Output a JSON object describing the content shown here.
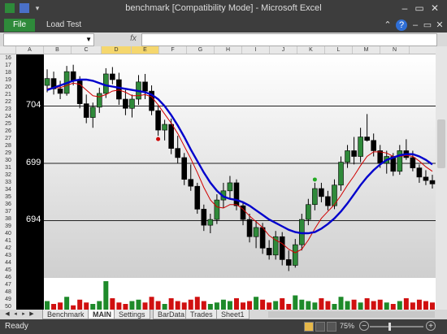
{
  "window": {
    "title": "benchmark  [Compatibility Mode]  -  Microsoft Excel"
  },
  "ribbon": {
    "file_label": "File",
    "tabs": [
      "Load Test"
    ]
  },
  "formula_bar": {
    "fx": "fx",
    "value": ""
  },
  "column_headers": [
    "A",
    "B",
    "C",
    "D",
    "E",
    "F",
    "G",
    "H",
    "I",
    "J",
    "K",
    "L",
    "M",
    "N"
  ],
  "selected_columns": [
    "D",
    "E"
  ],
  "row_headers": [
    "16",
    "17",
    "18",
    "19",
    "20",
    "21",
    "22",
    "23",
    "24",
    "25",
    "26",
    "27",
    "28",
    "29",
    "30",
    "31",
    "32",
    "33",
    "34",
    "35",
    "36",
    "37",
    "38",
    "39",
    "40",
    "41",
    "42",
    "43",
    "44",
    "45",
    "46",
    "47",
    "48",
    "49",
    "50"
  ],
  "sheet_tabs": [
    "Benchmark",
    "MAIN",
    "Settings",
    "BarData",
    "Trades",
    "Sheet1"
  ],
  "active_sheet": "MAIN",
  "status": {
    "ready": "Ready",
    "zoom": "75%"
  },
  "colors": {
    "up": "#2f8a3a",
    "down": "#000000",
    "ma_fast": "#d00000",
    "ma_slow": "#0000cc",
    "volume_up": "#1e8a2a",
    "volume_down": "#d01010",
    "signal_up": "#22aa22",
    "signal_down": "#cc0000"
  },
  "chart_data": {
    "type": "candlestick",
    "y_ticks": [
      704,
      699,
      694
    ],
    "ylim": [
      689.0,
      708.5
    ],
    "gridlines": true,
    "ohlc": [
      [
        705.8,
        707.2,
        705.2,
        706.4
      ],
      [
        706.4,
        707.0,
        705.0,
        705.5
      ],
      [
        705.5,
        706.2,
        704.6,
        705.1
      ],
      [
        705.1,
        707.5,
        704.9,
        707.0
      ],
      [
        707.0,
        707.6,
        705.8,
        706.2
      ],
      [
        706.2,
        706.6,
        703.8,
        704.2
      ],
      [
        704.2,
        705.0,
        702.5,
        703.0
      ],
      [
        703.0,
        704.3,
        702.1,
        703.9
      ],
      [
        703.9,
        705.6,
        703.4,
        705.1
      ],
      [
        705.1,
        707.3,
        704.7,
        706.8
      ],
      [
        706.8,
        707.4,
        705.9,
        706.3
      ],
      [
        706.3,
        706.9,
        704.1,
        704.6
      ],
      [
        704.6,
        705.4,
        703.2,
        703.8
      ],
      [
        703.8,
        705.0,
        703.0,
        704.6
      ],
      [
        704.6,
        706.7,
        704.1,
        706.1
      ],
      [
        706.1,
        706.8,
        704.6,
        705.3
      ],
      [
        705.3,
        705.8,
        703.2,
        703.6
      ],
      [
        703.6,
        704.0,
        701.4,
        701.9
      ],
      [
        701.9,
        702.8,
        701.0,
        702.4
      ],
      [
        702.4,
        702.9,
        699.8,
        700.3
      ],
      [
        700.3,
        701.4,
        699.0,
        699.5
      ],
      [
        699.5,
        699.9,
        697.1,
        697.6
      ],
      [
        697.6,
        698.9,
        696.6,
        697.0
      ],
      [
        697.0,
        697.3,
        694.6,
        695.0
      ],
      [
        695.0,
        695.4,
        693.1,
        693.6
      ],
      [
        693.6,
        694.6,
        692.9,
        694.1
      ],
      [
        694.1,
        696.3,
        693.7,
        695.8
      ],
      [
        695.8,
        697.3,
        695.1,
        696.6
      ],
      [
        696.6,
        697.9,
        695.9,
        697.3
      ],
      [
        697.3,
        697.6,
        694.9,
        695.3
      ],
      [
        695.3,
        695.6,
        693.6,
        694.1
      ],
      [
        694.1,
        694.6,
        692.1,
        692.6
      ],
      [
        692.6,
        694.0,
        691.6,
        693.4
      ],
      [
        693.4,
        693.8,
        691.1,
        691.6
      ],
      [
        691.6,
        692.3,
        690.6,
        691.0
      ],
      [
        691.0,
        693.1,
        690.6,
        692.6
      ],
      [
        692.6,
        693.0,
        690.1,
        690.6
      ],
      [
        690.6,
        691.4,
        689.6,
        690.1
      ],
      [
        690.1,
        692.4,
        689.9,
        691.9
      ],
      [
        691.9,
        694.6,
        691.4,
        694.1
      ],
      [
        694.1,
        695.9,
        693.6,
        695.4
      ],
      [
        695.4,
        697.3,
        694.9,
        696.8
      ],
      [
        696.8,
        697.3,
        695.6,
        696.1
      ],
      [
        696.1,
        696.6,
        694.9,
        695.3
      ],
      [
        695.3,
        697.6,
        695.0,
        697.1
      ],
      [
        697.1,
        699.6,
        696.6,
        699.1
      ],
      [
        699.1,
        700.6,
        698.6,
        700.1
      ],
      [
        700.1,
        701.3,
        698.9,
        699.6
      ],
      [
        699.6,
        702.1,
        699.1,
        701.3
      ],
      [
        701.3,
        703.3,
        700.9,
        701.0
      ],
      [
        701.0,
        701.6,
        699.6,
        700.1
      ],
      [
        700.1,
        700.6,
        698.6,
        699.0
      ],
      [
        699.0,
        700.1,
        698.1,
        699.6
      ],
      [
        699.6,
        699.9,
        697.9,
        698.3
      ],
      [
        698.3,
        700.6,
        698.0,
        700.1
      ],
      [
        700.1,
        701.1,
        699.3,
        699.5
      ],
      [
        699.5,
        700.1,
        698.3,
        698.6
      ],
      [
        698.6,
        698.9,
        697.3,
        697.8
      ],
      [
        697.8,
        698.4,
        697.1,
        697.5
      ],
      [
        697.5,
        698.0,
        696.8,
        697.2
      ]
    ],
    "ma_fast": [
      705.5,
      705.6,
      705.6,
      705.8,
      706.0,
      705.9,
      705.4,
      704.9,
      704.8,
      705.0,
      705.3,
      705.4,
      705.2,
      704.9,
      704.9,
      705.0,
      704.8,
      704.1,
      703.3,
      702.5,
      701.6,
      700.5,
      699.4,
      698.2,
      696.9,
      695.8,
      695.2,
      695.1,
      695.4,
      695.4,
      695.0,
      694.4,
      693.9,
      693.4,
      692.7,
      692.3,
      692.0,
      691.5,
      691.2,
      691.5,
      692.3,
      693.3,
      694.2,
      694.8,
      695.4,
      696.2,
      697.1,
      697.9,
      698.8,
      699.6,
      700.0,
      700.0,
      699.9,
      699.6,
      699.6,
      699.7,
      699.6,
      699.2,
      698.7,
      698.3
    ],
    "ma_slow": [
      705.4,
      705.6,
      705.8,
      706.0,
      706.2,
      706.3,
      706.3,
      706.2,
      706.0,
      705.8,
      705.7,
      705.6,
      705.5,
      705.4,
      705.3,
      705.2,
      705.0,
      704.6,
      704.0,
      703.2,
      702.3,
      701.3,
      700.2,
      699.2,
      698.2,
      697.3,
      696.6,
      696.1,
      695.9,
      695.8,
      695.6,
      695.3,
      694.9,
      694.5,
      694.1,
      693.8,
      693.5,
      693.2,
      693.0,
      692.9,
      692.9,
      693.0,
      693.3,
      693.7,
      694.2,
      694.8,
      695.5,
      696.3,
      697.1,
      697.8,
      698.4,
      698.9,
      699.3,
      699.5,
      699.7,
      699.8,
      699.8,
      699.6,
      699.3,
      698.9
    ],
    "volume": [
      6,
      4,
      5,
      9,
      3,
      7,
      5,
      4,
      6,
      20,
      8,
      5,
      4,
      6,
      7,
      5,
      9,
      6,
      4,
      8,
      6,
      5,
      7,
      9,
      6,
      4,
      5,
      7,
      6,
      8,
      5,
      6,
      9,
      7,
      5,
      6,
      8,
      4,
      10,
      7,
      6,
      5,
      8,
      6,
      4,
      9,
      6,
      7,
      5,
      8,
      6,
      7,
      5,
      4,
      6,
      8,
      5,
      7,
      6,
      5
    ],
    "signals": [
      {
        "index": 17,
        "dir": "down"
      },
      {
        "index": 41,
        "dir": "up"
      }
    ]
  }
}
